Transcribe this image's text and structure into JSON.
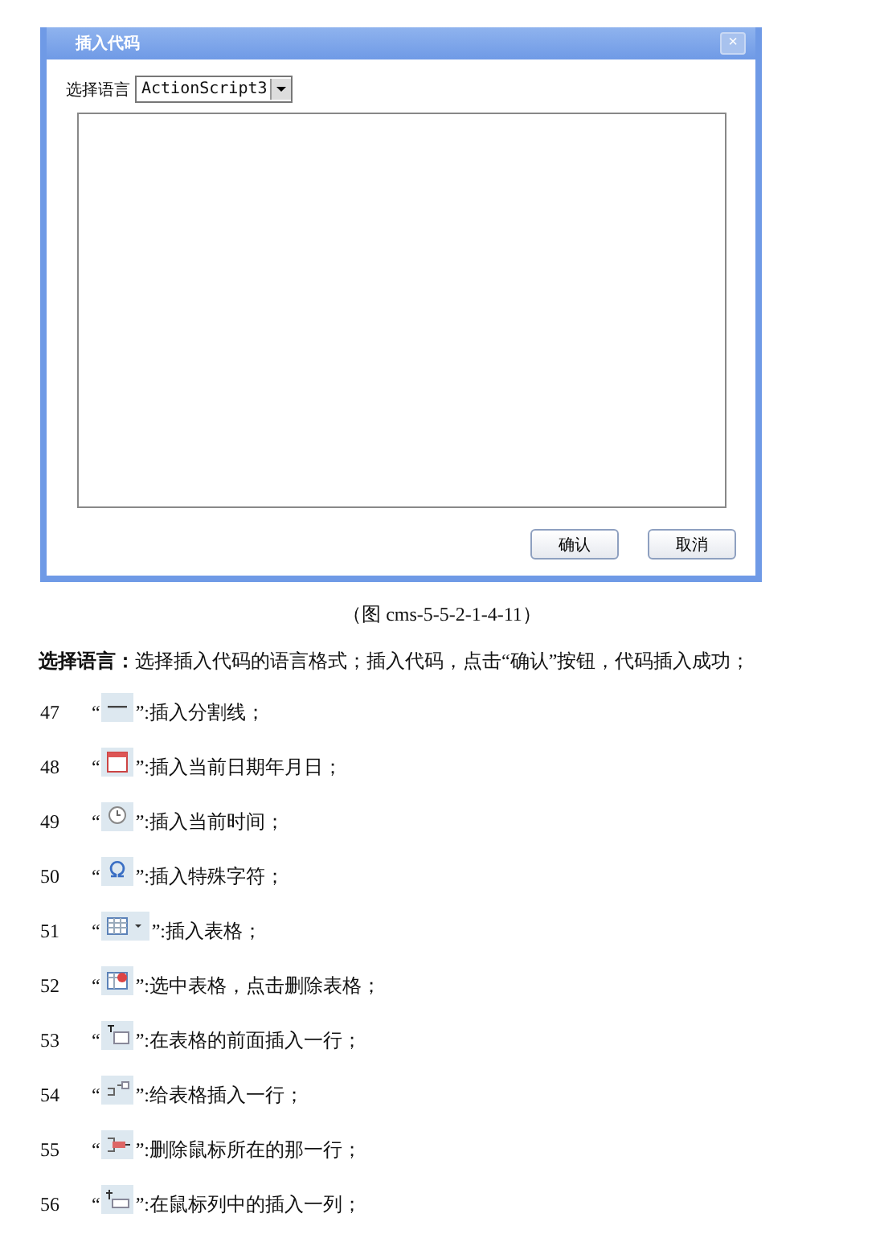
{
  "dialog": {
    "title": "插入代码",
    "close": "×",
    "language_label": "选择语言",
    "language_value": "ActionScript3",
    "buttons": [
      "确认",
      "取消"
    ]
  },
  "caption": "（图 cms-5-5-2-1-4-11）",
  "description": "**选择语言：**选择插入代码的语言格式；插入代码，点击“确认”按钮，代码插入成功；",
  "items": [
    {
      "number": "47",
      "open": "“",
      "kind": "rule",
      "close": "”",
      "text": ":插入分割线；"
    },
    {
      "number": "48",
      "open": "“",
      "kind": "calendar",
      "close": "”",
      "text": ":插入当前日期年月日；"
    },
    {
      "number": "49",
      "open": "“",
      "kind": "clock",
      "close": "”",
      "text": ":插入当前时间；"
    },
    {
      "number": "50",
      "open": "“",
      "kind": "omega",
      "close": "”",
      "text": ":插入特殊字符；"
    },
    {
      "number": "51",
      "open": "“",
      "kind": "table",
      "close": "”",
      "text": ":插入表格；"
    },
    {
      "number": "52",
      "open": "“",
      "kind": "table-delete",
      "close": "”",
      "text": ":选中表格，点击删除表格；"
    },
    {
      "number": "53",
      "open": "“",
      "kind": "row-before",
      "close": "”",
      "text": ":在表格的前面插入一行；"
    },
    {
      "number": "54",
      "open": "“",
      "kind": "row-insert",
      "close": "”",
      "text": ":给表格插入一行；"
    },
    {
      "number": "55",
      "open": "“",
      "kind": "row-delete",
      "close": "”",
      "text": ":删除鼠标所在的那一行；"
    },
    {
      "number": "56",
      "open": "“",
      "kind": "column-insert",
      "close": "”",
      "text": ":在鼠标列中的插入一列；"
    }
  ]
}
